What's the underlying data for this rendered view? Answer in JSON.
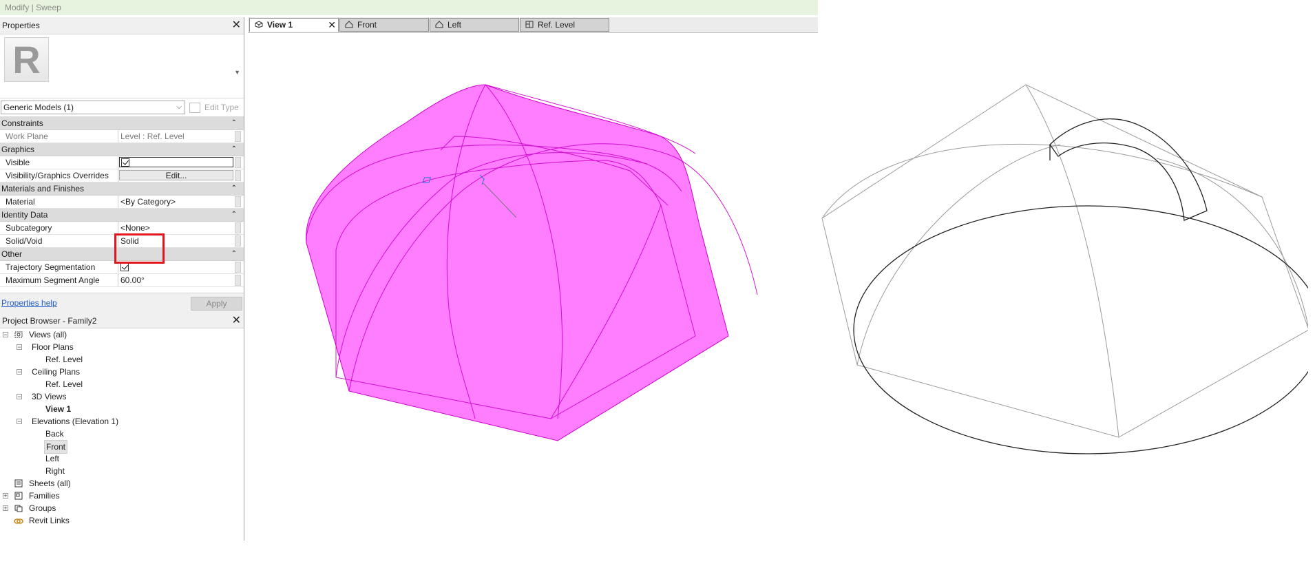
{
  "title": "Modify | Sweep",
  "properties": {
    "header": "Properties",
    "type_selector": "Generic Models (1)",
    "edit_type": "Edit Type",
    "groups": [
      {
        "name": "Constraints",
        "rows": [
          {
            "label": "Work Plane",
            "value": "Level : Ref. Level"
          }
        ]
      },
      {
        "name": "Graphics",
        "rows": [
          {
            "label": "Visible",
            "value": ""
          },
          {
            "label": "Visibility/Graphics Overrides",
            "value": "Edit..."
          }
        ]
      },
      {
        "name": "Materials and Finishes",
        "rows": [
          {
            "label": "Material",
            "value": "<By Category>"
          }
        ]
      },
      {
        "name": "Identity Data",
        "rows": [
          {
            "label": "Subcategory",
            "value": "<None>"
          },
          {
            "label": "Solid/Void",
            "value": "Solid"
          }
        ]
      },
      {
        "name": "Other",
        "rows": [
          {
            "label": "Trajectory Segmentation",
            "value": ""
          },
          {
            "label": "Maximum Segment Angle",
            "value": "60.00°"
          }
        ]
      }
    ],
    "help_link": "Properties help",
    "apply": "Apply"
  },
  "project_browser": {
    "header": "Project Browser - Family2",
    "items": [
      {
        "label": "Views (all)"
      },
      {
        "label": "Floor Plans"
      },
      {
        "label": "Ref. Level"
      },
      {
        "label": "Ceiling Plans"
      },
      {
        "label": "Ref. Level"
      },
      {
        "label": "3D Views"
      },
      {
        "label": "View 1"
      },
      {
        "label": "Elevations (Elevation 1)"
      },
      {
        "label": "Back"
      },
      {
        "label": "Front"
      },
      {
        "label": "Left"
      },
      {
        "label": "Right"
      },
      {
        "label": "Sheets (all)"
      },
      {
        "label": "Families"
      },
      {
        "label": "Groups"
      },
      {
        "label": "Revit Links"
      }
    ]
  },
  "view_tabs": [
    {
      "label": "View 1"
    },
    {
      "label": "Front"
    },
    {
      "label": "Left"
    },
    {
      "label": "Ref. Level"
    }
  ],
  "colors": {
    "sweep_fill": "#ff66ff",
    "sweep_edge": "#cc00cc",
    "highlight": "#e2161f",
    "ribbon_bg": "#e7f3df"
  }
}
